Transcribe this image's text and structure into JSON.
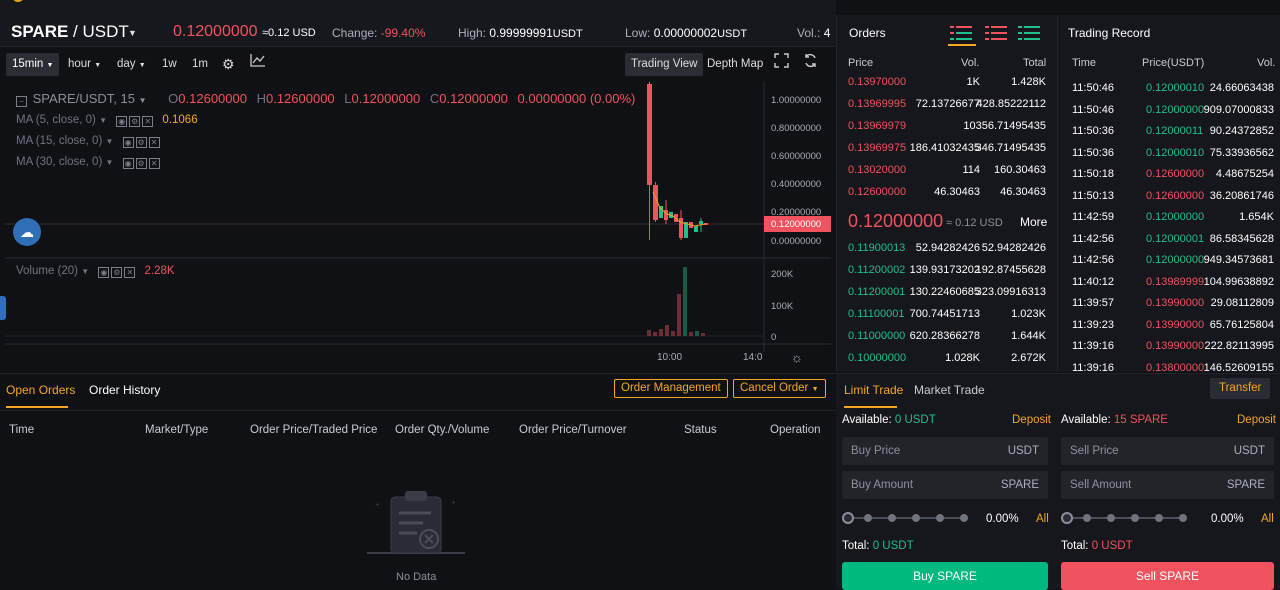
{
  "header": {
    "base": "SPARE",
    "quote": "USDT",
    "last_price": "0.12000000",
    "last_price_usd": "≈0.12 USD",
    "change_label": "Change:",
    "change_value": "-99.40%",
    "high_label": "High:",
    "high_value": "0.99999991",
    "high_unit": "USDT",
    "low_label": "Low:",
    "low_value": "0.00000002",
    "low_unit": "USDT",
    "vol_label": "Vol.:",
    "vol_value": "4"
  },
  "toolbar": {
    "intervals": [
      "15min",
      "hour",
      "day",
      "1w",
      "1m"
    ],
    "trading_view": "Trading View",
    "depth_map": "Depth Map"
  },
  "chart": {
    "symbol": "SPARE/USDT, 15",
    "o_label": "O",
    "o_value": "0.12600000",
    "h_label": "H",
    "h_value": "0.12600000",
    "l_label": "L",
    "l_value": "0.12000000",
    "c_label": "C",
    "c_value": "0.12000000",
    "change": "0.00000000 (0.00%)",
    "ma5": "MA (5, close, 0)",
    "ma5_value": "0.1066",
    "ma15": "MA (15, close, 0)",
    "ma30": "MA (30, close, 0)",
    "volume": "Volume (20)",
    "volume_value": "2.28K",
    "price_axis": [
      "1.00000000",
      "0.80000000",
      "0.60000000",
      "0.40000000",
      "0.20000000",
      "0.12000000",
      "0.00000000"
    ],
    "vol_axis": [
      "200K",
      "100K",
      "0"
    ],
    "time_axis": [
      "10:00",
      "14:0"
    ]
  },
  "orders": {
    "title": "Orders",
    "col_price": "Price",
    "col_vol": "Vol.",
    "col_total": "Total",
    "asks": [
      {
        "price": "0.13970000",
        "vol": "1K",
        "total": "1.428K"
      },
      {
        "price": "0.13969995",
        "vol": "72.13726677",
        "total": "428.85222112"
      },
      {
        "price": "0.13969979",
        "vol": "",
        "total": "10356.71495435"
      },
      {
        "price": "0.13969975",
        "vol": "186.41032435",
        "total": "346.71495435"
      },
      {
        "price": "0.13020000",
        "vol": "114",
        "total": "160.30463"
      },
      {
        "price": "0.12600000",
        "vol": "46.30463",
        "total": "46.30463"
      }
    ],
    "mid_price": "0.12000000",
    "mid_usd": "≈ 0.12 USD",
    "more": "More",
    "bids": [
      {
        "price": "0.11900013",
        "vol": "52.94282426",
        "total": "52.94282426"
      },
      {
        "price": "0.11200002",
        "vol": "139.93173202",
        "total": "192.87455628"
      },
      {
        "price": "0.11200001",
        "vol": "130.22460685",
        "total": "323.09916313"
      },
      {
        "price": "0.11100001",
        "vol": "700.74451713",
        "total": "1.023K"
      },
      {
        "price": "0.11000000",
        "vol": "620.28366278",
        "total": "1.644K"
      },
      {
        "price": "0.10000000",
        "vol": "1.028K",
        "total": "2.672K"
      }
    ]
  },
  "records": {
    "title": "Trading Record",
    "col_time": "Time",
    "col_price": "Price(USDT)",
    "col_vol": "Vol.",
    "rows": [
      {
        "time": "11:50:46",
        "price": "0.12000010",
        "vol": "24.66063438",
        "side": "buy"
      },
      {
        "time": "11:50:46",
        "price": "0.12000000",
        "vol": "909.07000833",
        "side": "buy"
      },
      {
        "time": "11:50:36",
        "price": "0.12000011",
        "vol": "90.24372852",
        "side": "buy"
      },
      {
        "time": "11:50:36",
        "price": "0.12000010",
        "vol": "75.33936562",
        "side": "buy"
      },
      {
        "time": "11:50:18",
        "price": "0.12600000",
        "vol": "4.48675254",
        "side": "sell"
      },
      {
        "time": "11:50:13",
        "price": "0.12600000",
        "vol": "36.20861746",
        "side": "sell"
      },
      {
        "time": "11:42:59",
        "price": "0.12000000",
        "vol": "1.654K",
        "side": "buy"
      },
      {
        "time": "11:42:56",
        "price": "0.12000001",
        "vol": "86.58345628",
        "side": "buy"
      },
      {
        "time": "11:42:56",
        "price": "0.12000000",
        "vol": "949.34573681",
        "side": "buy"
      },
      {
        "time": "11:40:12",
        "price": "0.13989999",
        "vol": "104.99638892",
        "side": "sell"
      },
      {
        "time": "11:39:57",
        "price": "0.13990000",
        "vol": "29.08112809",
        "side": "sell"
      },
      {
        "time": "11:39:23",
        "price": "0.13990000",
        "vol": "65.76125804",
        "side": "sell"
      },
      {
        "time": "11:39:16",
        "price": "0.13990000",
        "vol": "222.82113995",
        "side": "sell"
      },
      {
        "time": "11:39:16",
        "price": "0.13800000",
        "vol": "146.52609155",
        "side": "sell"
      }
    ]
  },
  "bottom": {
    "tab_open": "Open Orders",
    "tab_history": "Order History",
    "order_management": "Order Management",
    "cancel_order": "Cancel Order",
    "columns": [
      "Time",
      "Market/Type",
      "Order Price/Traded Price",
      "Order Qty./Volume",
      "Order Price/Turnover",
      "Status",
      "Operation"
    ],
    "empty": "No Data"
  },
  "trade": {
    "tab_limit": "Limit Trade",
    "tab_market": "Market Trade",
    "transfer": "Transfer",
    "available_label": "Available:",
    "buy_available": "0 USDT",
    "sell_available": "15 SPARE",
    "deposit": "Deposit",
    "buy_price_placeholder": "Buy Price",
    "buy_amount_placeholder": "Buy Amount",
    "sell_price_placeholder": "Sell Price",
    "sell_amount_placeholder": "Sell Amount",
    "unit_usdt": "USDT",
    "unit_spare": "SPARE",
    "percent": "0.00%",
    "all": "All",
    "total_label": "Total:",
    "buy_total": "0 USDT",
    "sell_total": "0 USDT",
    "buy_button": "Buy SPARE",
    "sell_button": "Sell SPARE"
  },
  "colors": {
    "up": "#1fc08b",
    "down": "#f0525f",
    "accent": "#f5a623",
    "buy_button": "#00b97e",
    "sell_button": "#f0525f"
  }
}
